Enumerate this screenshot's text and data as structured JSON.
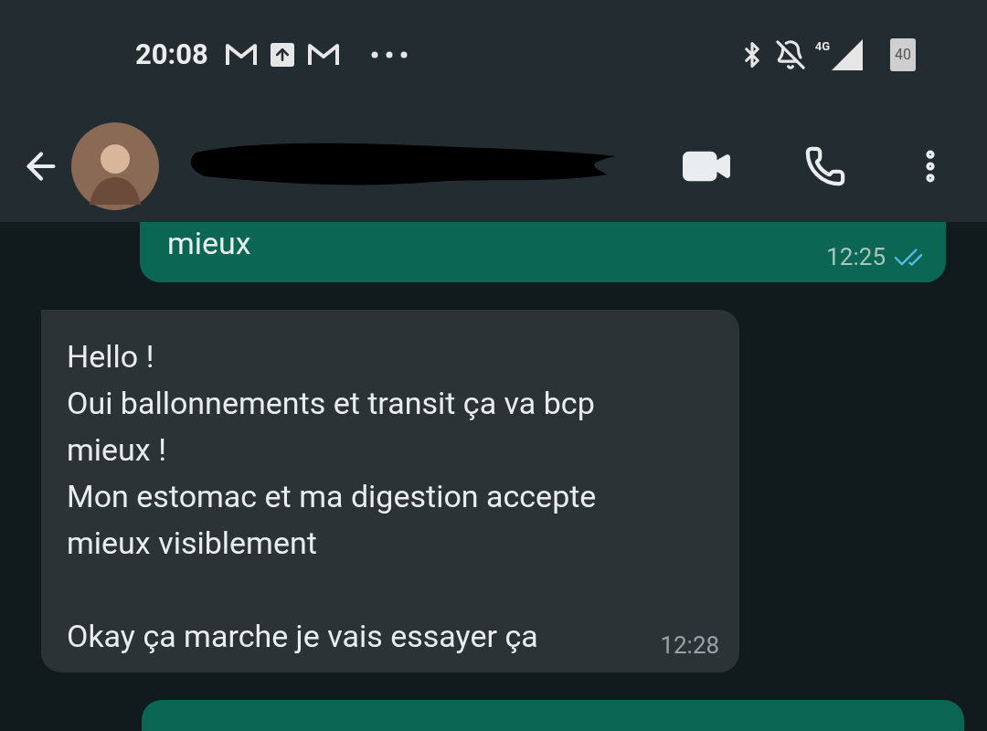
{
  "status_bar": {
    "time": "20:08",
    "network": "4G",
    "battery": "40"
  },
  "messages": [
    {
      "kind": "outgoing",
      "text": "mieux",
      "time": "12:25",
      "read": true
    },
    {
      "kind": "incoming",
      "text": "Hello !\nOui ballonnements et transit ça va bcp\nmieux !\nMon estomac et ma digestion accepte\nmieux visiblement\n\nOkay ça marche je vais essayer ça",
      "time": "12:28"
    },
    {
      "kind": "outgoing_partial"
    }
  ]
}
